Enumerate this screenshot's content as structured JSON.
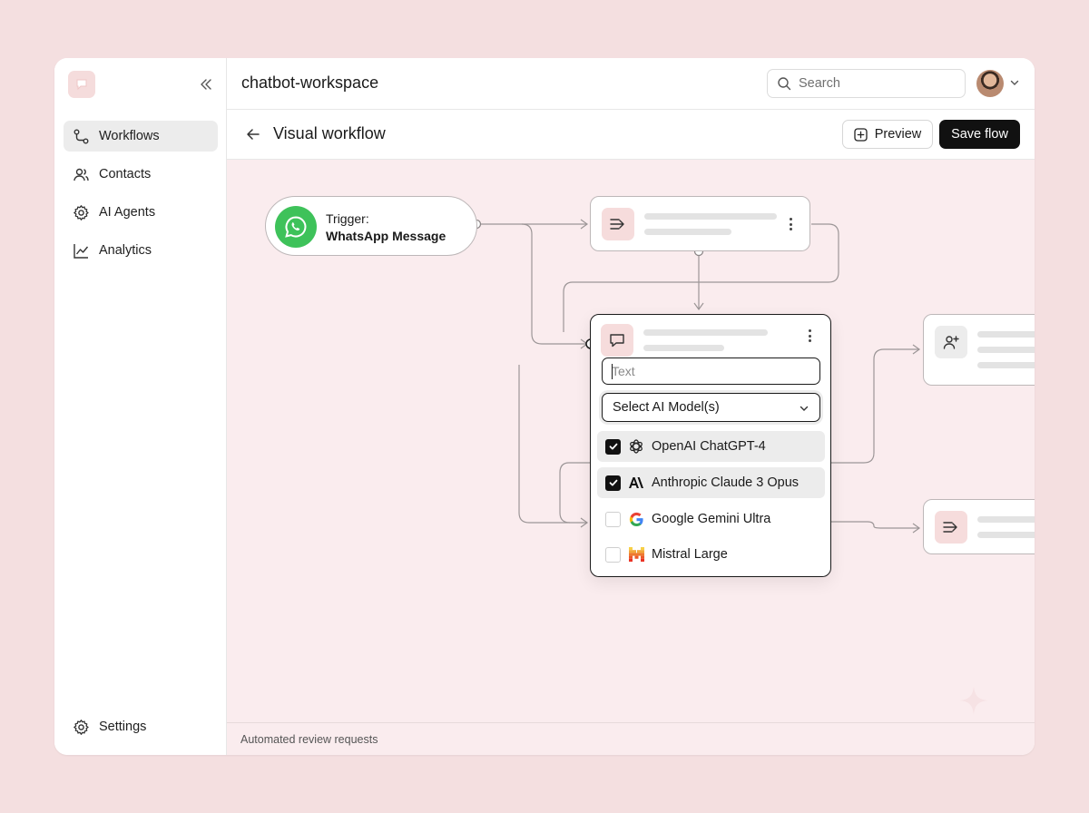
{
  "sidebar": {
    "items": [
      {
        "label": "Workflows",
        "icon": "workflow-icon",
        "active": true
      },
      {
        "label": "Contacts",
        "icon": "users-icon"
      },
      {
        "label": "AI Agents",
        "icon": "gear-icon"
      },
      {
        "label": "Analytics",
        "icon": "chart-icon"
      }
    ],
    "settings_label": "Settings"
  },
  "header": {
    "workspace": "chatbot-workspace",
    "search_placeholder": "Search"
  },
  "subheader": {
    "title": "Visual workflow",
    "preview_label": "Preview",
    "save_label": "Save flow"
  },
  "canvas": {
    "trigger": {
      "line1": "Trigger:",
      "line2": "WhatsApp Message"
    },
    "ai_node": {
      "text_placeholder": "Text",
      "select_label": "Select AI Model(s)",
      "models": [
        {
          "label": "OpenAI ChatGPT-4",
          "checked": true,
          "icon": "openai-icon"
        },
        {
          "label": "Anthropic Claude 3 Opus",
          "checked": true,
          "icon": "anthropic-icon"
        },
        {
          "label": "Google Gemini Ultra",
          "checked": false,
          "icon": "google-icon"
        },
        {
          "label": "Mistral Large",
          "checked": false,
          "icon": "mistral-icon"
        }
      ]
    }
  },
  "footer": {
    "text": "Automated review requests"
  },
  "colors": {
    "accent_pink": "#f6dcdc",
    "whatsapp_green": "#3ec25a",
    "canvas_bg": "#faecee"
  }
}
